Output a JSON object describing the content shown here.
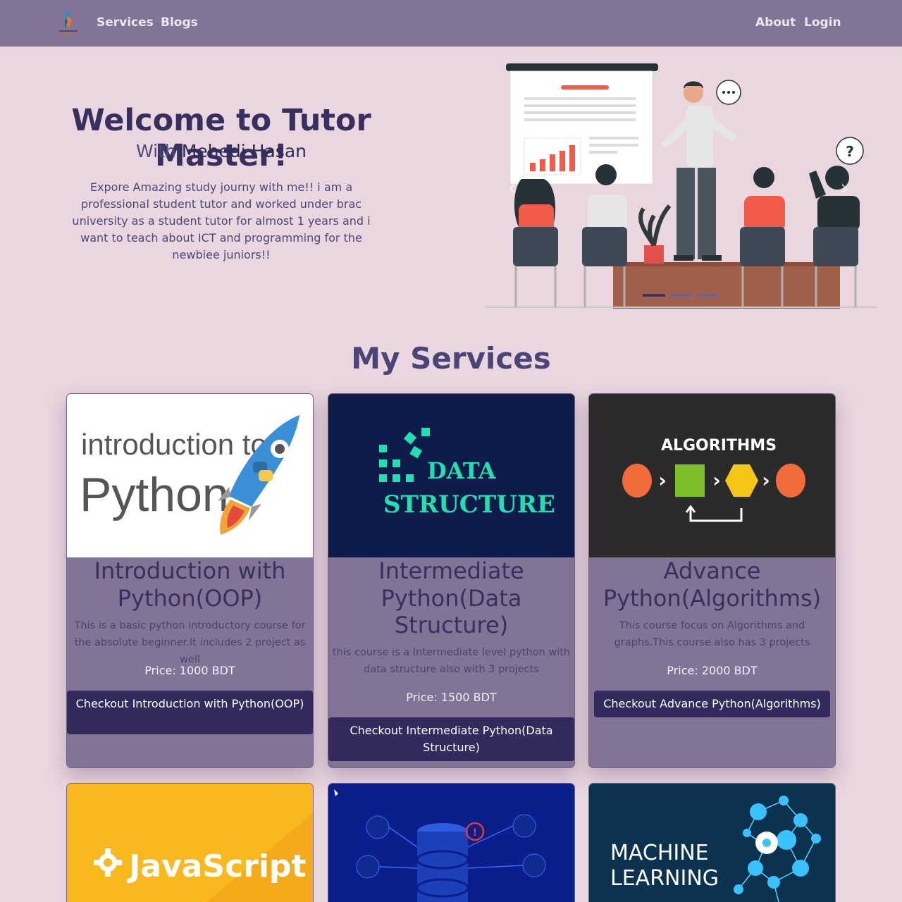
{
  "nav": {
    "links_left": [
      "Services",
      "Blogs"
    ],
    "links_right": [
      "About",
      "Login"
    ]
  },
  "hero": {
    "title": "Welcome to Tutor Master!",
    "subtitle_prefix": "With",
    "subtitle_name": "Mehedi Hasan",
    "description": "Expore Amazing study journy with me!! i am a professional student tutor and worked under brac university as a student tutor for almost 1 years and i want to teach about ICT and programming for the newbiee juniors!!",
    "carousel_slide_count": 3,
    "carousel_active_index": 0
  },
  "services": {
    "title": "My Services",
    "cards": [
      {
        "image_text_1": "introduction to",
        "image_text_2": "Python",
        "title": "Introduction with Python(OOP)",
        "description": "This is a basic python introductory course for the absolute beginner.It includes 2 project as well",
        "price": "Price: 1000 BDT",
        "button": "Checkout Introduction with Python(OOP)"
      },
      {
        "image_text_1": "DATA",
        "image_text_2": "STRUCTURE",
        "title": "Intermediate Python(Data Structure)",
        "description": "this course is a Intermediate level python with data structure also with 3 projects",
        "price": "Price: 1500 BDT",
        "button": "Checkout Intermediate Python(Data Structure)"
      },
      {
        "image_text_1": "ALGORITHMS",
        "title": "Advance Python(Algorithms)",
        "description": "This course focus on Algorithms and graphs.This course also has 3 projects",
        "price": "Price: 2000 BDT",
        "button": "Checkout Advance Python(Algorithms)"
      }
    ],
    "more_cards": [
      {
        "image_text": "JavaScript"
      },
      {
        "image_text": ""
      },
      {
        "image_text_1": "MACHINE",
        "image_text_2": "LEARNING"
      }
    ]
  },
  "colors": {
    "nav_bg": "#827496",
    "page_bg": "#ead6de",
    "card_bg": "#837497",
    "button_bg": "#332a5e",
    "title_text": "#37305e"
  }
}
